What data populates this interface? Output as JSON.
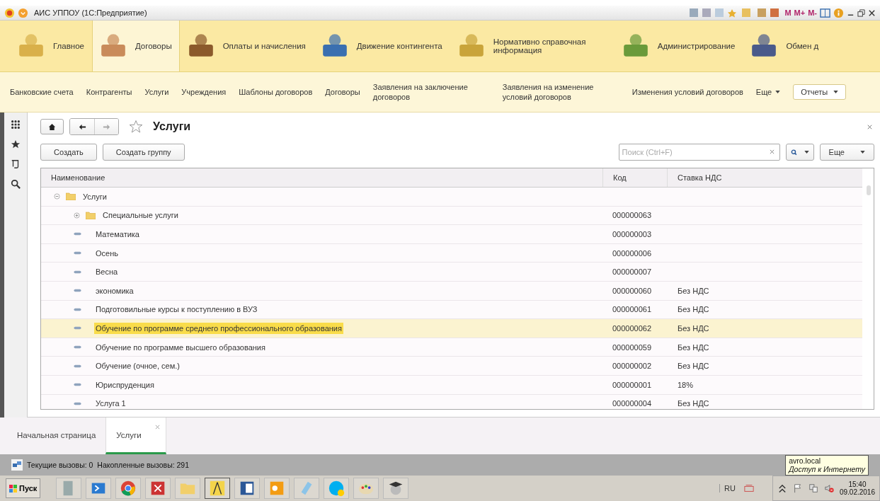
{
  "window": {
    "title": "АИС УППОУ (1С:Предприятие)",
    "toolbar_texts": [
      "M",
      "M+",
      "M-"
    ]
  },
  "sections": [
    {
      "label": "Главное",
      "selected": false
    },
    {
      "label": "Договоры",
      "selected": true
    },
    {
      "label": "Оплаты и начисления",
      "selected": false
    },
    {
      "label": "Движение контингента",
      "selected": false
    },
    {
      "label": "Нормативно справочная информация",
      "selected": false
    },
    {
      "label": "Администрирование",
      "selected": false
    },
    {
      "label": "Обмен д",
      "selected": false
    }
  ],
  "subnav": {
    "items": [
      "Банковские счета",
      "Контрагенты",
      "Услуги",
      "Учреждения",
      "Шаблоны договоров",
      "Договоры",
      "Заявления на заключение договоров",
      "Заявления на изменение условий договоров",
      "Изменения условий договоров"
    ],
    "more": "Еще",
    "reports": "Отчеты"
  },
  "page": {
    "title": "Услуги",
    "buttons": [
      "Создать",
      "Создать группу"
    ],
    "search": {
      "placeholder": "Поиск (Ctrl+F)"
    },
    "more": "Еще"
  },
  "table": {
    "columns": [
      "Наименование",
      "Код",
      "Ставка НДС"
    ],
    "rows": [
      {
        "kind": "group",
        "name": "Услуги",
        "expanded": true,
        "selected": false,
        "children": [
          {
            "kind": "group",
            "name": "Специальные услуги",
            "code": "000000063",
            "expanded": false,
            "selected": false
          },
          {
            "kind": "item",
            "name": "Математика",
            "code": "000000003",
            "selected": false
          },
          {
            "kind": "item",
            "name": "Осень",
            "code": "000000006",
            "selected": false
          },
          {
            "kind": "item",
            "name": "Весна",
            "code": "000000007",
            "selected": false
          },
          {
            "kind": "item",
            "name": "экономика",
            "code": "000000060",
            "vat": "Без НДС",
            "selected": false
          },
          {
            "kind": "item",
            "name": "Подготовильные курсы к поступлению в ВУЗ",
            "code": "000000061",
            "vat": "Без НДС",
            "selected": false
          },
          {
            "kind": "item",
            "name": "Обучение по программе среднего профессионального образования",
            "code": "000000062",
            "vat": "Без НДС",
            "selected": true
          },
          {
            "kind": "item",
            "name": "Обучение по программе высшего образования",
            "code": "000000059",
            "vat": "Без НДС",
            "selected": false
          },
          {
            "kind": "item",
            "name": "Обучение (очное, сем.)",
            "code": "000000002",
            "vat": "Без НДС",
            "selected": false
          },
          {
            "kind": "item",
            "name": "Юриспруденция",
            "code": "000000001",
            "vat": "18%",
            "selected": false
          },
          {
            "kind": "item",
            "name": "Услуга 1",
            "code": "000000004",
            "vat": "Без НДС",
            "selected": false
          }
        ]
      }
    ]
  },
  "tabs": [
    {
      "label": "Начальная страница",
      "selected": false
    },
    {
      "label": "Услуги",
      "selected": true
    }
  ],
  "status_bar": {
    "current": "Текущие вызовы: 0",
    "accumulated": "Накопленные вызовы: 291"
  },
  "taskbar": {
    "start": "Пуск",
    "language": "RU",
    "time": "15:40",
    "date": "09.02.2016"
  },
  "tooltip": {
    "host": "avro.local",
    "status": "Доступ к Интернету"
  }
}
